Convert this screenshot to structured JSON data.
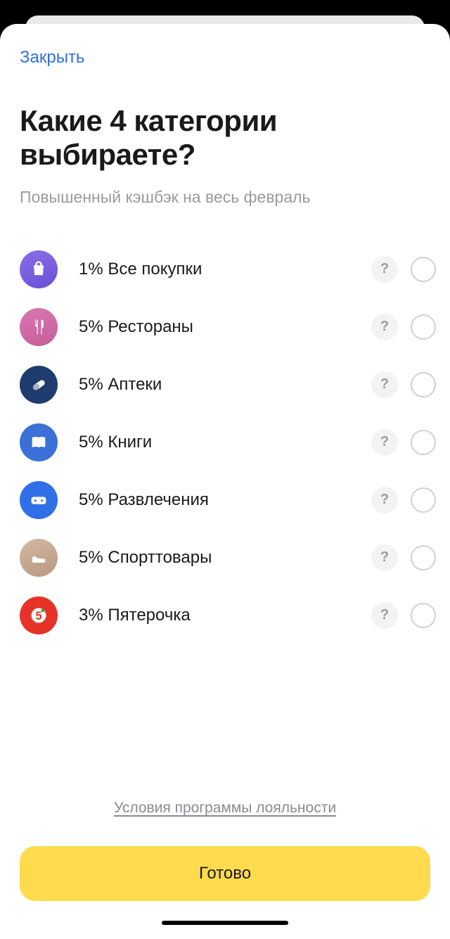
{
  "close_label": "Закрыть",
  "title": "Какие 4 категории выбираете?",
  "subtitle": "Повышенный кэшбэк на весь февраль",
  "help_glyph": "?",
  "terms_label": "Условия программы лояльности",
  "done_label": "Готово",
  "categories": [
    {
      "id": "all",
      "percent": 1,
      "name": "Все покупки",
      "label": "1% Все покупки",
      "icon": "shopping-bag-icon",
      "selected": false
    },
    {
      "id": "restaurants",
      "percent": 5,
      "name": "Рестораны",
      "label": "5% Рестораны",
      "icon": "utensils-icon",
      "selected": false
    },
    {
      "id": "pharmacy",
      "percent": 5,
      "name": "Аптеки",
      "label": "5% Аптеки",
      "icon": "pill-icon",
      "selected": false
    },
    {
      "id": "books",
      "percent": 5,
      "name": "Книги",
      "label": "5% Книги",
      "icon": "book-icon",
      "selected": false
    },
    {
      "id": "ent",
      "percent": 5,
      "name": "Развлечения",
      "label": "5% Развлечения",
      "icon": "gamepad-icon",
      "selected": false
    },
    {
      "id": "sport",
      "percent": 5,
      "name": "Спорттовары",
      "label": "5% Спорттовары",
      "icon": "sneaker-icon",
      "selected": false
    },
    {
      "id": "pyaterochka",
      "percent": 3,
      "name": "Пятерочка",
      "label": "3% Пятерочка",
      "icon": "pyaterochka-icon",
      "selected": false
    }
  ]
}
